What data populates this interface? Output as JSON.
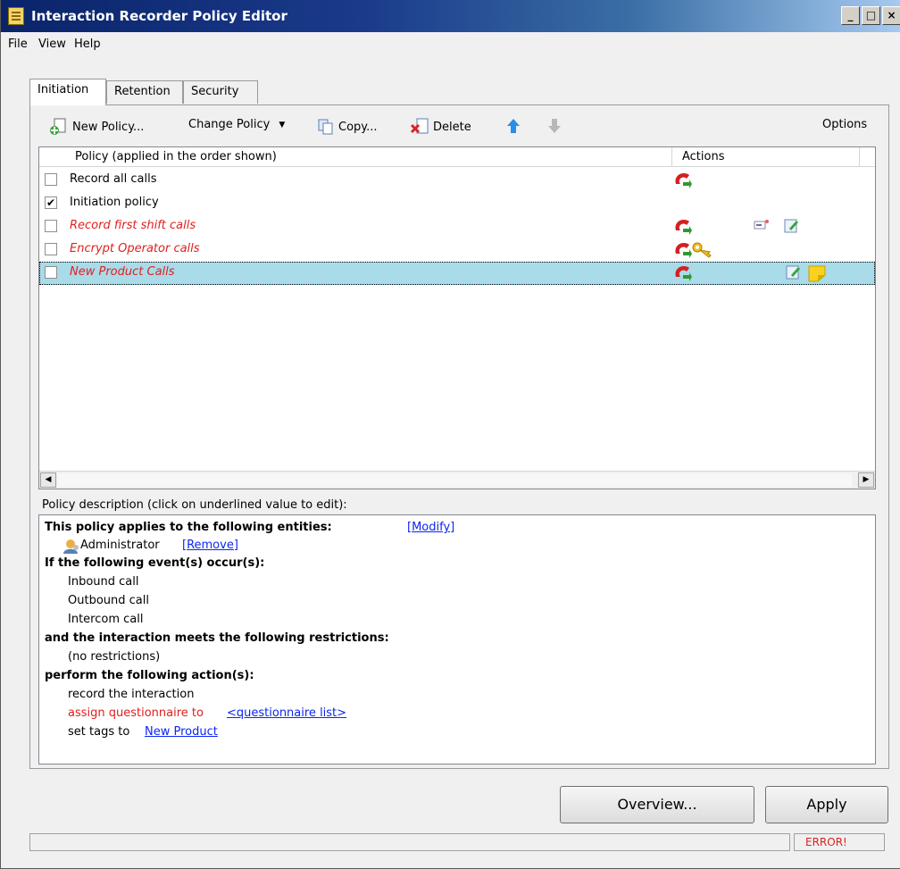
{
  "window": {
    "title": "Interaction Recorder Policy Editor"
  },
  "menu": [
    "File",
    "View",
    "Help"
  ],
  "tabs": [
    {
      "label": "Initiation",
      "active": true
    },
    {
      "label": "Retention",
      "active": false
    },
    {
      "label": "Security",
      "active": false
    }
  ],
  "toolbar": {
    "new_policy": "New Policy...",
    "change_policy": "Change Policy",
    "copy": "Copy...",
    "delete": "Delete",
    "options": "Options"
  },
  "list": {
    "columns": [
      "Policy (applied in the order shown)",
      "Actions"
    ],
    "rows": [
      {
        "label": "Record all calls",
        "checked": false,
        "style": "normal"
      },
      {
        "label": "Initiation policy",
        "checked": true,
        "style": "normal"
      },
      {
        "label": "Record first shift calls",
        "checked": false,
        "style": "red-italic"
      },
      {
        "label": "Encrypt Operator calls",
        "checked": false,
        "style": "red-italic"
      },
      {
        "label": "New Product Calls",
        "checked": false,
        "style": "red-italic",
        "selected": true
      }
    ]
  },
  "description": {
    "label": "Policy description (click on underlined value to edit):",
    "applies_heading": "This policy applies to the following entities:",
    "modify_link": "[Modify]",
    "entity": "Administrator",
    "remove_link": "[Remove]",
    "events_heading": "If the following event(s) occur(s):",
    "events": [
      "Inbound call",
      "Outbound call",
      "Intercom call"
    ],
    "restrictions_heading": "and the interaction meets the following restrictions:",
    "restrictions": "(no restrictions)",
    "actions_heading": "perform the following action(s):",
    "action_record": "record the interaction",
    "action_questionnaire": "assign questionnaire to",
    "questionnaire_link": "<questionnaire list>",
    "action_tags": "set tags to",
    "tags_link": "New Product"
  },
  "buttons": {
    "overview": "Overview...",
    "apply": "Apply"
  },
  "status": {
    "error": "ERROR!"
  },
  "colors": {
    "title_bar": "#0a246a",
    "selected_row": "#a9dbe9",
    "red_text": "#e02020",
    "link": "#0b24f5"
  }
}
